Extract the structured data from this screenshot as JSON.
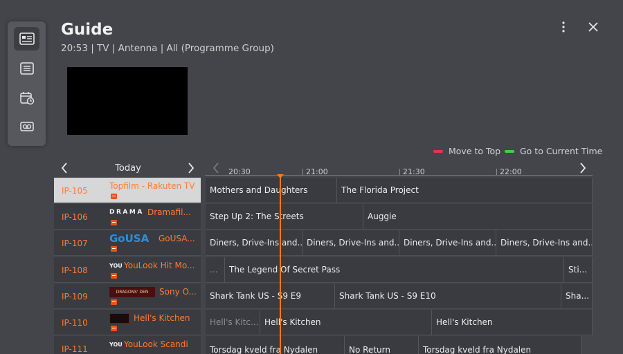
{
  "header": {
    "title": "Guide",
    "subtitle": "20:53 | TV | Antenna | All (Programme Group)"
  },
  "rail": {
    "items": [
      {
        "icon": "guide-icon",
        "active": true
      },
      {
        "icon": "list-icon",
        "active": false
      },
      {
        "icon": "schedule-icon",
        "active": false
      },
      {
        "icon": "recording-icon",
        "active": false
      }
    ]
  },
  "legend": {
    "move_to_top": {
      "label": "Move to Top",
      "color": "#e8334a"
    },
    "current_time": {
      "label": "Go to Current Time",
      "color": "#3ccf4a"
    }
  },
  "nav": {
    "day": "Today"
  },
  "timeline": {
    "labels": [
      "20:30",
      "21:00",
      "21:30",
      "22:00"
    ]
  },
  "channels": [
    {
      "number": "IP-105",
      "name": "Topfilm - Rakuten TV",
      "logo": ""
    },
    {
      "number": "IP-106",
      "name": "Dramafil...",
      "logo": "DRAMA"
    },
    {
      "number": "IP-107",
      "name": "GoUSA...",
      "logo": "GoUSA"
    },
    {
      "number": "IP-108",
      "name": "YouLook Hit Mo...",
      "logo": "YOU"
    },
    {
      "number": "IP-109",
      "name": "Sony O...",
      "logo": "DRAGONS' DEN"
    },
    {
      "number": "IP-110",
      "name": "Hell's Kitchen",
      "logo": ""
    },
    {
      "number": "IP-111",
      "name": "YouLook Scandi",
      "logo": "YOU"
    }
  ],
  "programs": [
    [
      {
        "title": "Mothers and Daughters"
      },
      {
        "title": "The Florida Project"
      }
    ],
    [
      {
        "title": "Step Up 2: The Streets"
      },
      {
        "title": "Auggie"
      }
    ],
    [
      {
        "title": "Diners, Drive-Ins and..."
      },
      {
        "title": "Diners, Drive-Ins and..."
      },
      {
        "title": "Diners, Drive-Ins and..."
      },
      {
        "title": "Diners, Drive-Ins and..."
      }
    ],
    [
      {
        "title": "..."
      },
      {
        "title": "The Legend Of Secret Pass"
      },
      {
        "title": "Sti..."
      }
    ],
    [
      {
        "title": "Shark Tank US - S9 E9"
      },
      {
        "title": "Shark Tank US - S9 E10"
      },
      {
        "title": "Sha..."
      }
    ],
    [
      {
        "title": "Hell's Kitc..."
      },
      {
        "title": "Hell's Kitchen"
      },
      {
        "title": "Hell's Kitchen"
      }
    ],
    [
      {
        "title": "Torsdag kveld fra Nydalen"
      },
      {
        "title": "No Return"
      },
      {
        "title": "Torsdag kveld fra Nydalen"
      }
    ]
  ]
}
